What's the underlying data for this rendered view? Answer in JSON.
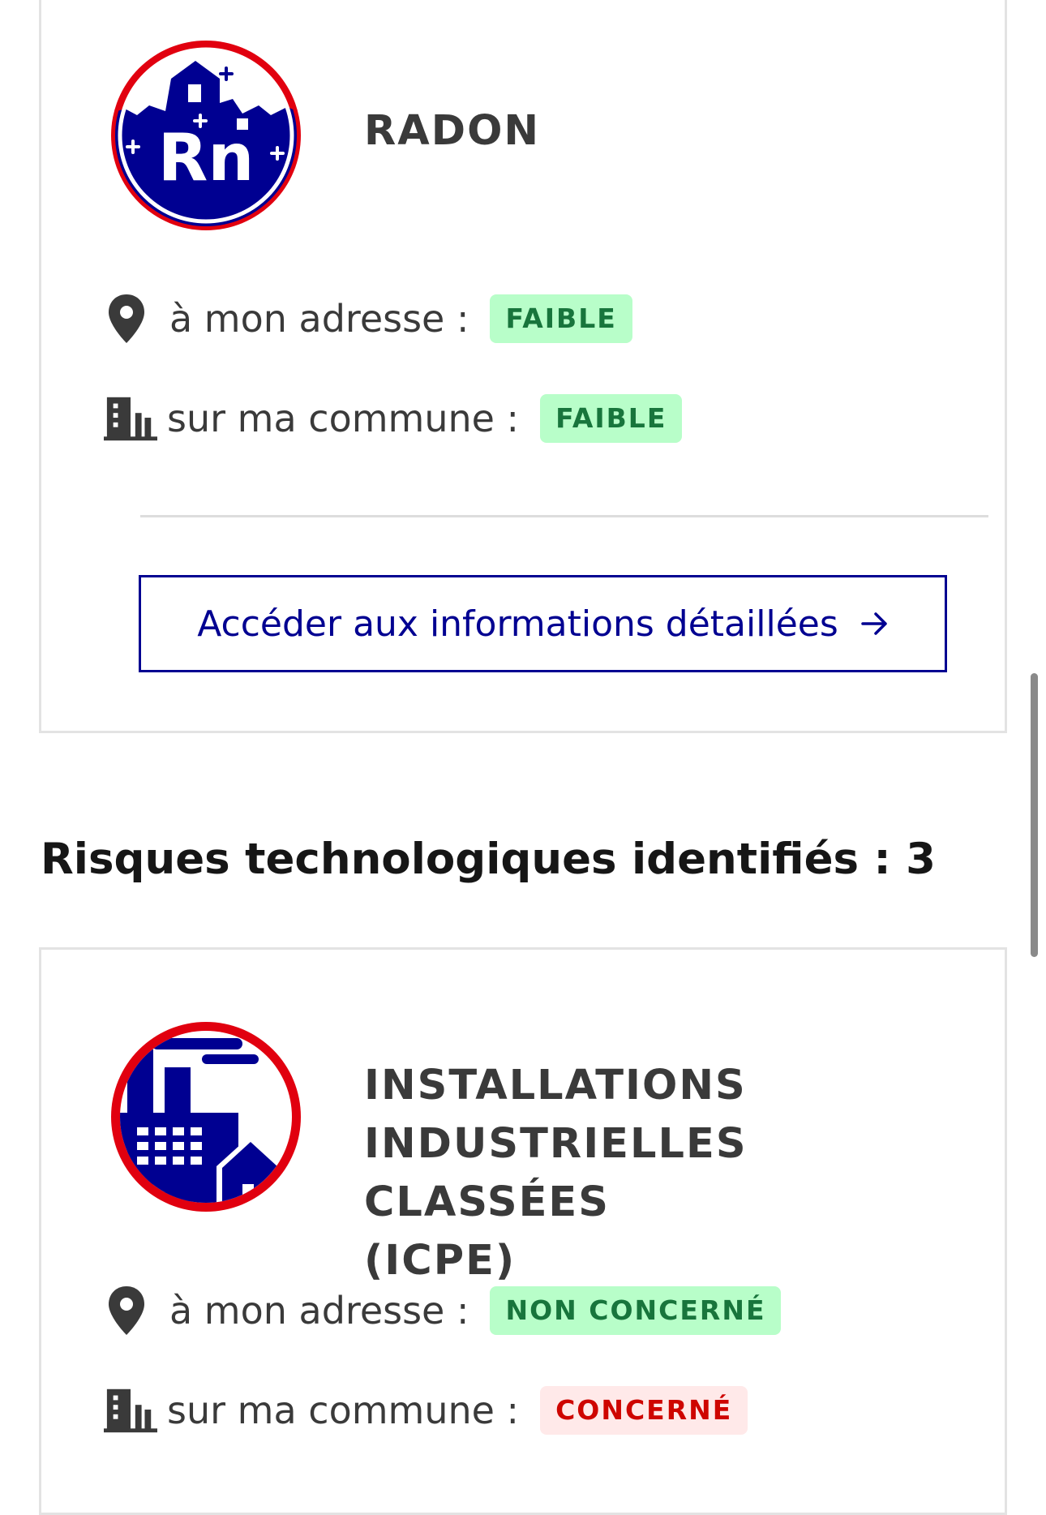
{
  "radon_card": {
    "title": "RADON",
    "icon": "radon-icon",
    "address_label": "à mon adresse :",
    "address_level": "FAIBLE",
    "commune_label": "sur ma commune :",
    "commune_level": "FAIBLE",
    "detail_button": "Accéder aux informations détaillées"
  },
  "section": {
    "title": "Risques technologiques identifiés : 3"
  },
  "icpe_card": {
    "title_lines": [
      "INSTALLATIONS",
      "INDUSTRIELLES CLASSÉES",
      "(ICPE)"
    ],
    "icon": "factory-icon",
    "address_label": "à mon adresse :",
    "address_level": "NON CONCERNÉ",
    "commune_label": "sur ma commune :",
    "commune_level": "CONCERNÉ"
  },
  "colors": {
    "accent": "#000091",
    "green_badge_bg": "#b8fec9",
    "green_badge_text": "#18753c",
    "red_badge_bg": "#ffe9e9",
    "red_badge_text": "#ce0500",
    "icon_ring": "#e1000f"
  }
}
